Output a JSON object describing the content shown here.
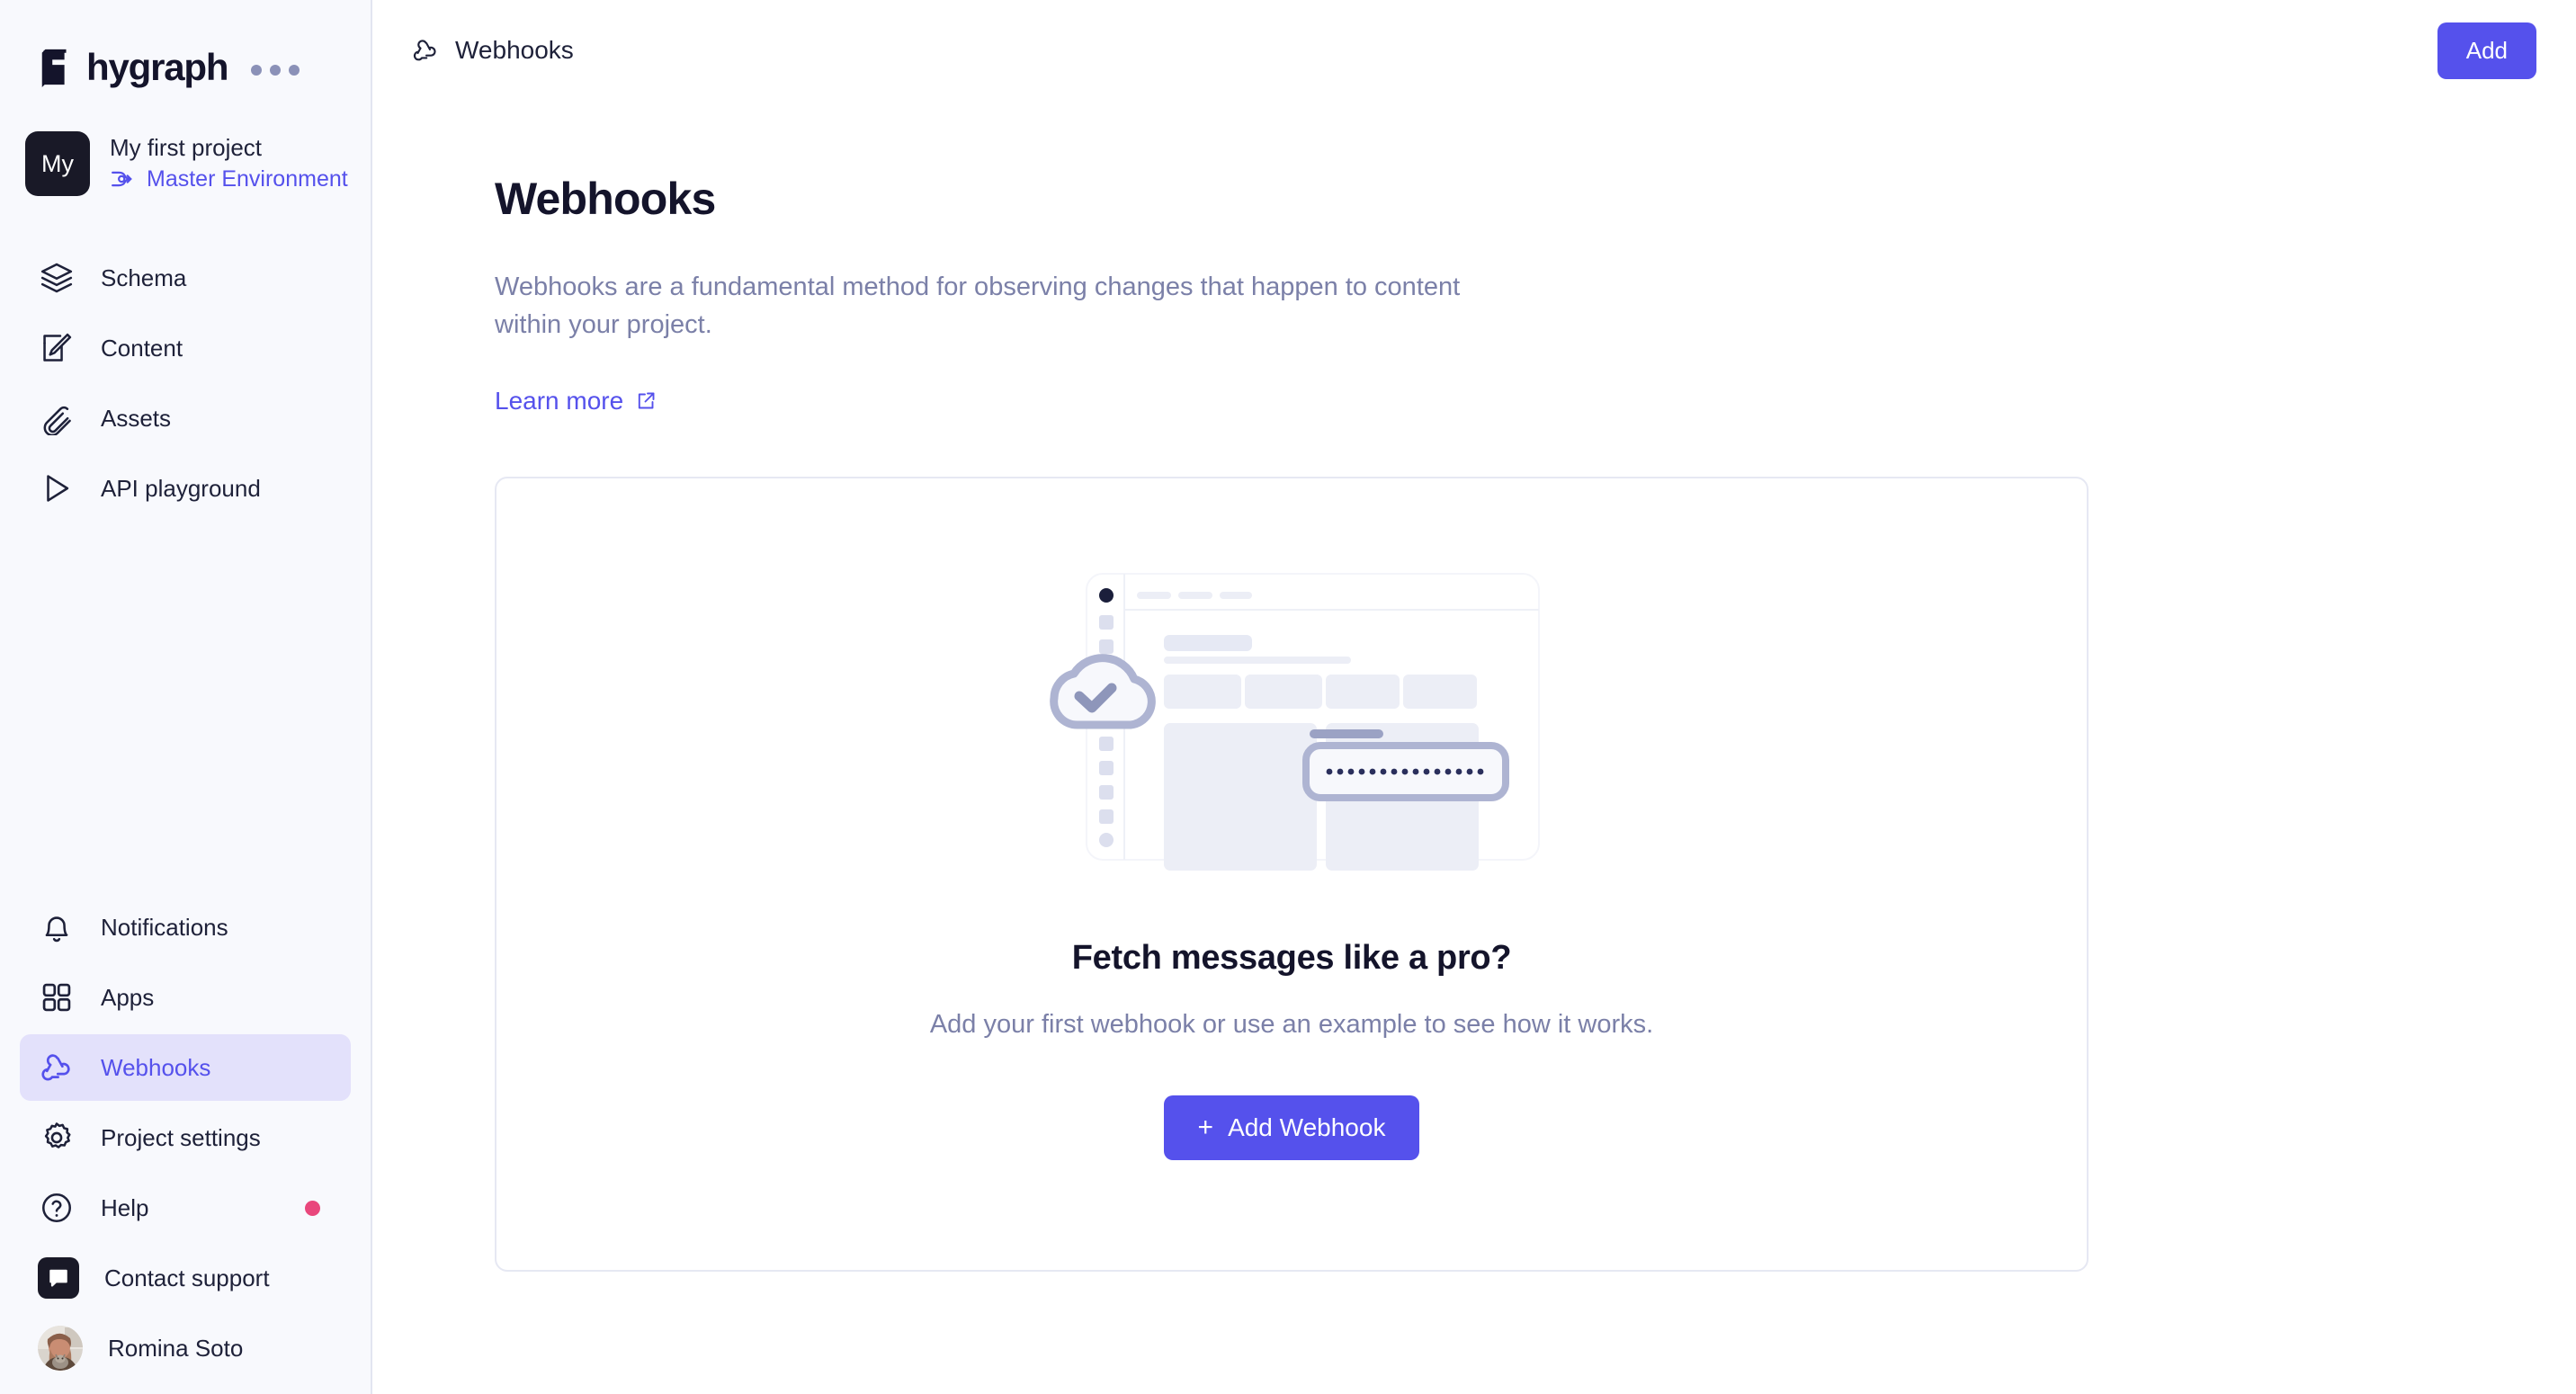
{
  "brand": {
    "name": "hygraph",
    "menu_icon": "ellipsis-icon"
  },
  "project": {
    "initials": "My",
    "name": "My first project",
    "environment": "Master Environment",
    "environment_icon": "branch-icon"
  },
  "sidebar": {
    "primary_items": [
      {
        "label": "Schema",
        "icon": "layers-icon",
        "active": false
      },
      {
        "label": "Content",
        "icon": "edit-square-icon",
        "active": false
      },
      {
        "label": "Assets",
        "icon": "paperclip-icon",
        "active": false
      },
      {
        "label": "API playground",
        "icon": "play-icon",
        "active": false
      }
    ],
    "secondary_items": [
      {
        "label": "Notifications",
        "icon": "bell-icon",
        "active": false
      },
      {
        "label": "Apps",
        "icon": "grid-icon",
        "active": false
      },
      {
        "label": "Webhooks",
        "icon": "webhook-icon",
        "active": true
      },
      {
        "label": "Project settings",
        "icon": "gear-icon",
        "active": false
      },
      {
        "label": "Help",
        "icon": "question-circle-icon",
        "active": false,
        "badge": true
      }
    ],
    "support": {
      "label": "Contact support",
      "icon": "chat-bubble-icon"
    },
    "user": {
      "name": "Romina Soto",
      "icon": "avatar"
    }
  },
  "topbar": {
    "title": "Webhooks",
    "title_icon": "webhook-icon",
    "add_label": "Add"
  },
  "page": {
    "title": "Webhooks",
    "description": "Webhooks are a fundamental method for observing changes that happen to content within your project.",
    "learn_more": "Learn more",
    "learn_more_icon": "external-link-icon"
  },
  "empty_state": {
    "illustration": "cloud-check-dashboard-illustration",
    "title": "Fetch messages like a pro?",
    "subtitle": "Add your first webhook or use an example to see how it works.",
    "button_label": "Add Webhook",
    "button_icon": "plus-icon"
  },
  "colors": {
    "accent": "#5551ec",
    "accent_soft": "#e3e1fb",
    "sidebar_bg": "#f8f9fd",
    "text_primary": "#1e2139",
    "text_muted": "#7b80a8",
    "badge": "#e9477c",
    "dark": "#191927",
    "border": "#e6e8f3"
  }
}
